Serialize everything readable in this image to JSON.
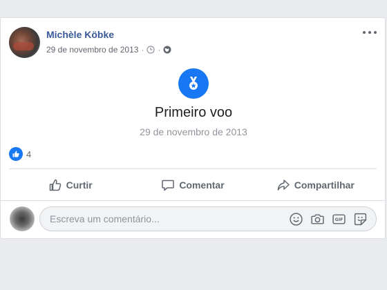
{
  "post": {
    "author": "Michèle Köbke",
    "date": "29 de novembro de 2013",
    "separator": "·",
    "privacy_icon": "globe-icon",
    "time_icon": "clock-icon",
    "menu_icon": "more-options-icon"
  },
  "event": {
    "icon": "medal-icon",
    "title": "Primeiro voo",
    "date": "29 de novembro de 2013"
  },
  "reactions": {
    "icon": "like-icon",
    "count": "4"
  },
  "actions": {
    "like_label": "Curtir",
    "comment_label": "Comentar",
    "share_label": "Compartilhar"
  },
  "comment": {
    "placeholder": "Escreva um comentário...",
    "icons": [
      "emoji-icon",
      "camera-icon",
      "gif-icon",
      "sticker-icon"
    ]
  },
  "colors": {
    "accent": "#1877f2",
    "author_link": "#385898",
    "muted_text": "#616770",
    "background": "#e9ebee"
  }
}
